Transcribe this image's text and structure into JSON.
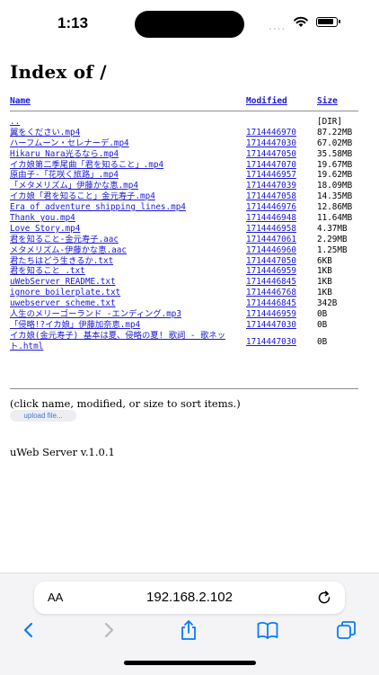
{
  "status_bar": {
    "time": "1:13",
    "signal_dots": "....",
    "wifi_icon": "wifi-icon",
    "battery_icon": "battery-icon"
  },
  "page": {
    "title": "Index of /",
    "headers": {
      "name": "Name",
      "modified": "Modified",
      "size": "Size"
    },
    "rows": [
      {
        "name": "..",
        "modified": "",
        "size": "[DIR]"
      },
      {
        "name": "翼をください.mp4",
        "modified": "1714446970",
        "size": "87.22MB"
      },
      {
        "name": "ハーフムーン・セレナーデ.mp4",
        "modified": "1714447030",
        "size": "67.02MB"
      },
      {
        "name": "Hikaru Nara光るなら.mp4",
        "modified": "1714447050",
        "size": "35.58MB"
      },
      {
        "name": "イカ娘第二季尾曲「君を知ること」.mp4",
        "modified": "1714447070",
        "size": "19.67MB"
      },
      {
        "name": "原由子-「花咲く旅路」.mp4",
        "modified": "1714446957",
        "size": "19.62MB"
      },
      {
        "name": "「メタメリズム」伊藤かな恵.mp4",
        "modified": "1714447039",
        "size": "18.09MB"
      },
      {
        "name": "イカ娘「君を知ること」金元寿子.mp4",
        "modified": "1714447058",
        "size": "14.35MB"
      },
      {
        "name": "Era of adventure shipping lines.mp4",
        "modified": "1714446976",
        "size": "12.86MB"
      },
      {
        "name": "Thank you.mp4",
        "modified": "1714446948",
        "size": "11.64MB"
      },
      {
        "name": "Love Story.mp4",
        "modified": "1714446958",
        "size": "4.37MB"
      },
      {
        "name": "君を知ること-金元寿子.aac",
        "modified": "1714447061",
        "size": "2.29MB"
      },
      {
        "name": "メタメリズム-伊藤かな恵.aac",
        "modified": "1714446960",
        "size": "1.25MB"
      },
      {
        "name": "君たちはどう生きるか.txt",
        "modified": "1714447050",
        "size": "6KB"
      },
      {
        "name": "君を知ること .txt",
        "modified": "1714446959",
        "size": "1KB"
      },
      {
        "name": "uWebServer README.txt",
        "modified": "1714446845",
        "size": "1KB"
      },
      {
        "name": "ignore boilerplate.txt",
        "modified": "1714446768",
        "size": "1KB"
      },
      {
        "name": "uwebserver scheme.txt",
        "modified": "1714446845",
        "size": "342B"
      },
      {
        "name": "人生のメリーゴーランド -エンディング.mp3",
        "modified": "1714446959",
        "size": "0B"
      },
      {
        "name": "「侵略!?イカ娘」伊藤加奈恵.mp4",
        "modified": "1714447030",
        "size": "0B"
      },
      {
        "name": "イカ娘(金元寿子) 基本は夏、侵略の夏! 歌詞 - 歌ネット.html",
        "modified": "1714447030",
        "size": "0B"
      }
    ],
    "note": "(click name, modified, or size to sort items.)",
    "upload_button": "upload file...",
    "server_version": "uWeb Server v.1.0.1"
  },
  "browser": {
    "aa_label": "AA",
    "url": "192.168.2.102",
    "icons": [
      "reload-icon",
      "back-icon",
      "forward-icon",
      "share-icon",
      "bookmarks-icon",
      "tabs-icon"
    ]
  },
  "colors": {
    "link": "#1a1ad6",
    "toolbar_bg": "#f4f4f6",
    "accent": "#0a7aff"
  }
}
